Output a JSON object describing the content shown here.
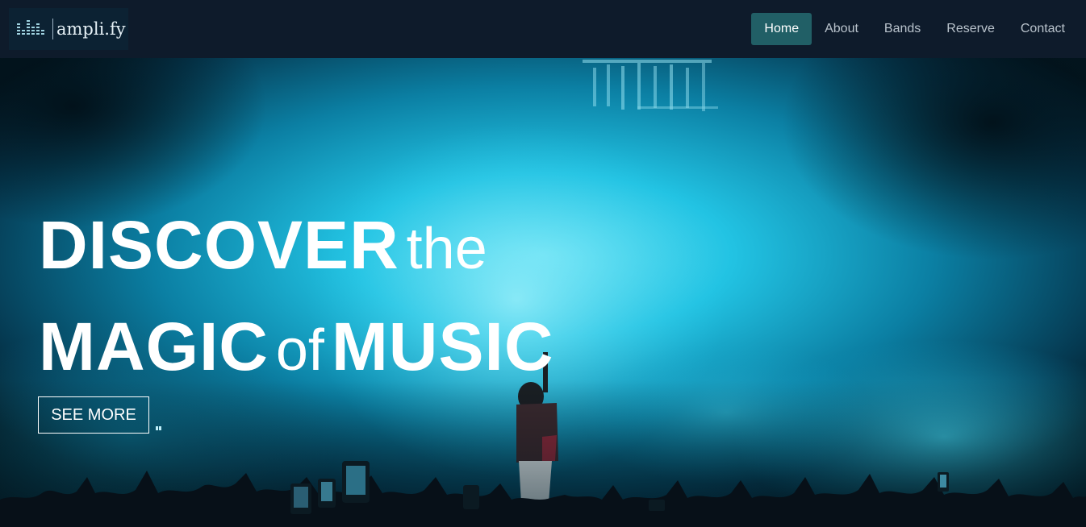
{
  "brand": {
    "name": "ampli.fy",
    "logo_icon": "equalizer-icon"
  },
  "nav": {
    "items": [
      {
        "label": "Home",
        "active": true
      },
      {
        "label": "About",
        "active": false
      },
      {
        "label": "Bands",
        "active": false
      },
      {
        "label": "Reserve",
        "active": false
      },
      {
        "label": "Contact",
        "active": false
      }
    ]
  },
  "hero": {
    "line1_strong": "DISCOVER",
    "line1_light": "the",
    "line2_strong1": "MAGIC",
    "line2_light": "of",
    "line2_strong2": "MUSIC",
    "cta_label": "SEE MORE",
    "background": "concert-stage-photo"
  },
  "colors": {
    "navbar_bg": "#0e1b2b",
    "nav_active_bg": "#215f66",
    "nav_text": "#b9c3cc",
    "hero_cyan": "#1fc3e4"
  }
}
